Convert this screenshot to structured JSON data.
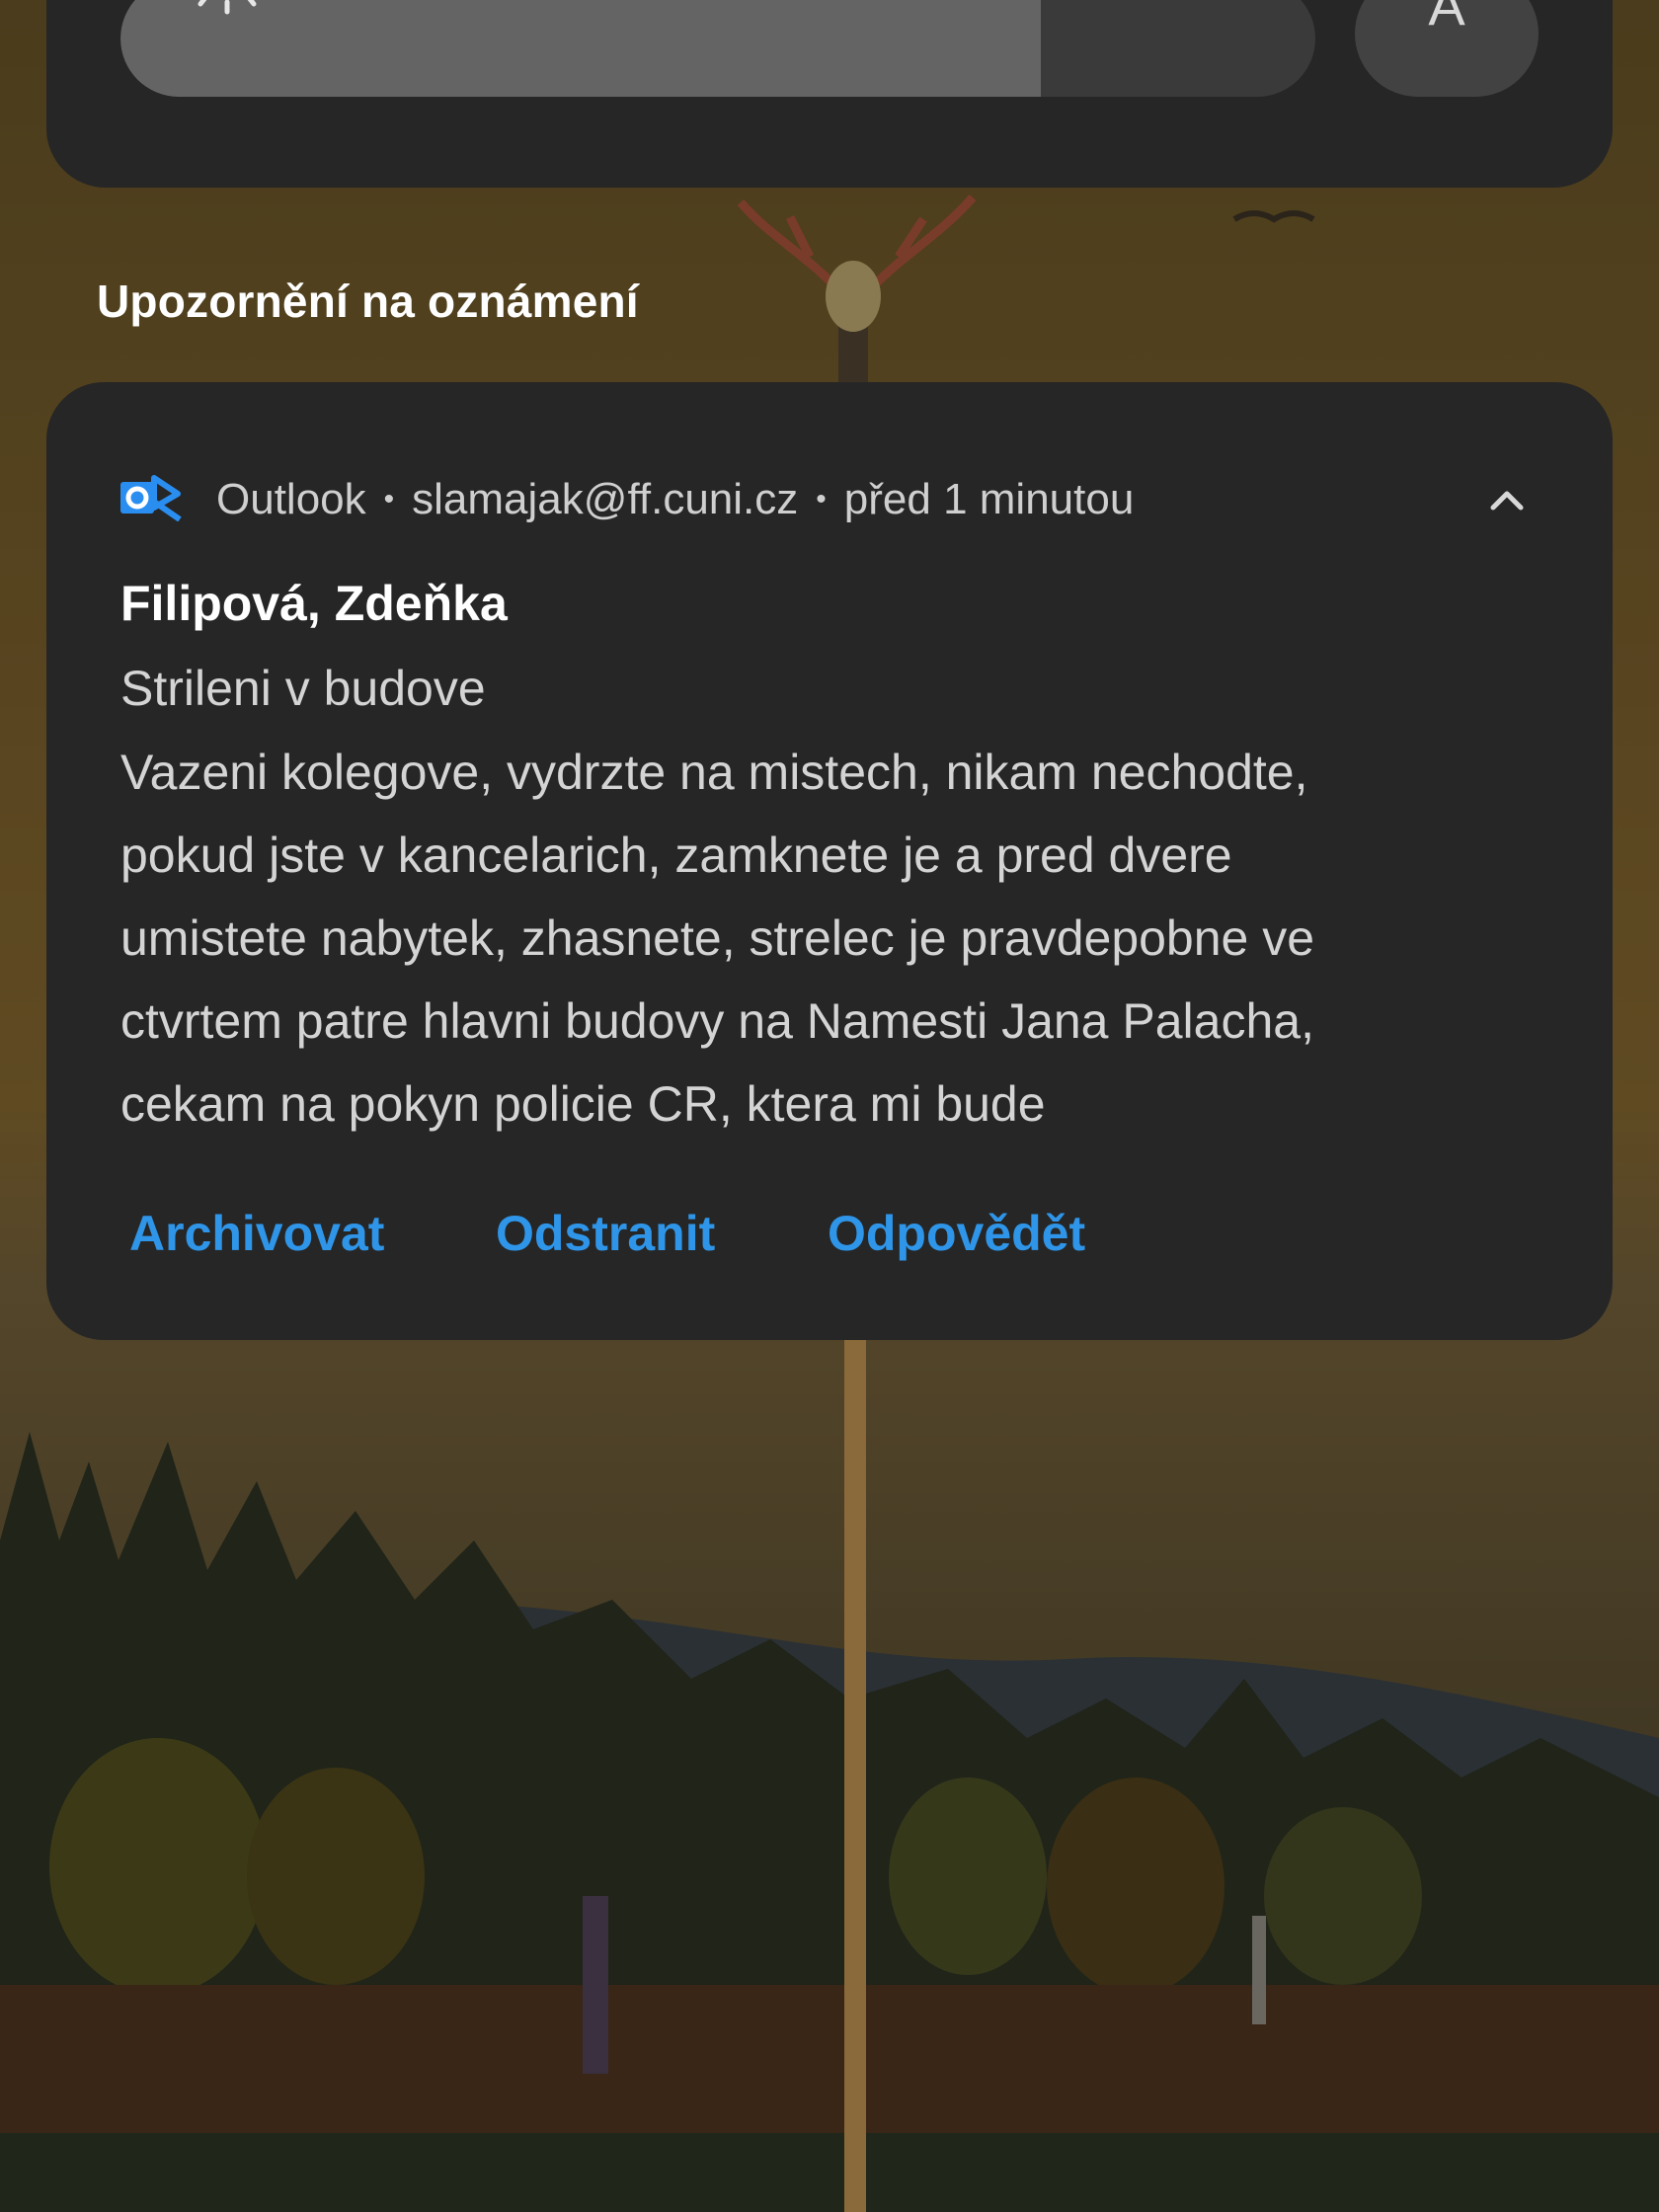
{
  "quick_settings": {
    "brightness_level": 0.77,
    "auto_button_label": "A"
  },
  "section_title": "Upozornění na oznámení",
  "notification": {
    "app_icon": "outlook-icon",
    "app_name": "Outlook",
    "account": "slamajak@ff.cuni.cz",
    "time": "před 1 minutou",
    "separator": "•",
    "sender": "Filipová, Zdeňka",
    "subject": "Strileni v budove",
    "body": [
      "Vazeni kolegove, vydrzte na mistech, nikam nechodte,",
      "pokud jste v kancelarich, zamknete je a pred dvere",
      "umistete nabytek, zhasnete, strelec je pravdepobne ve",
      "ctvrtem patre hlavni budovy na Namesti Jana Palacha,",
      "cekam na pokyn policie CR, ktera mi bude"
    ],
    "actions": {
      "archive": "Archivovat",
      "delete": "Odstranit",
      "reply": "Odpovědět"
    }
  },
  "colors": {
    "card_background": "#262626",
    "action_blue": "#2f95e8",
    "outlook_blue": "#2a8ef0"
  }
}
